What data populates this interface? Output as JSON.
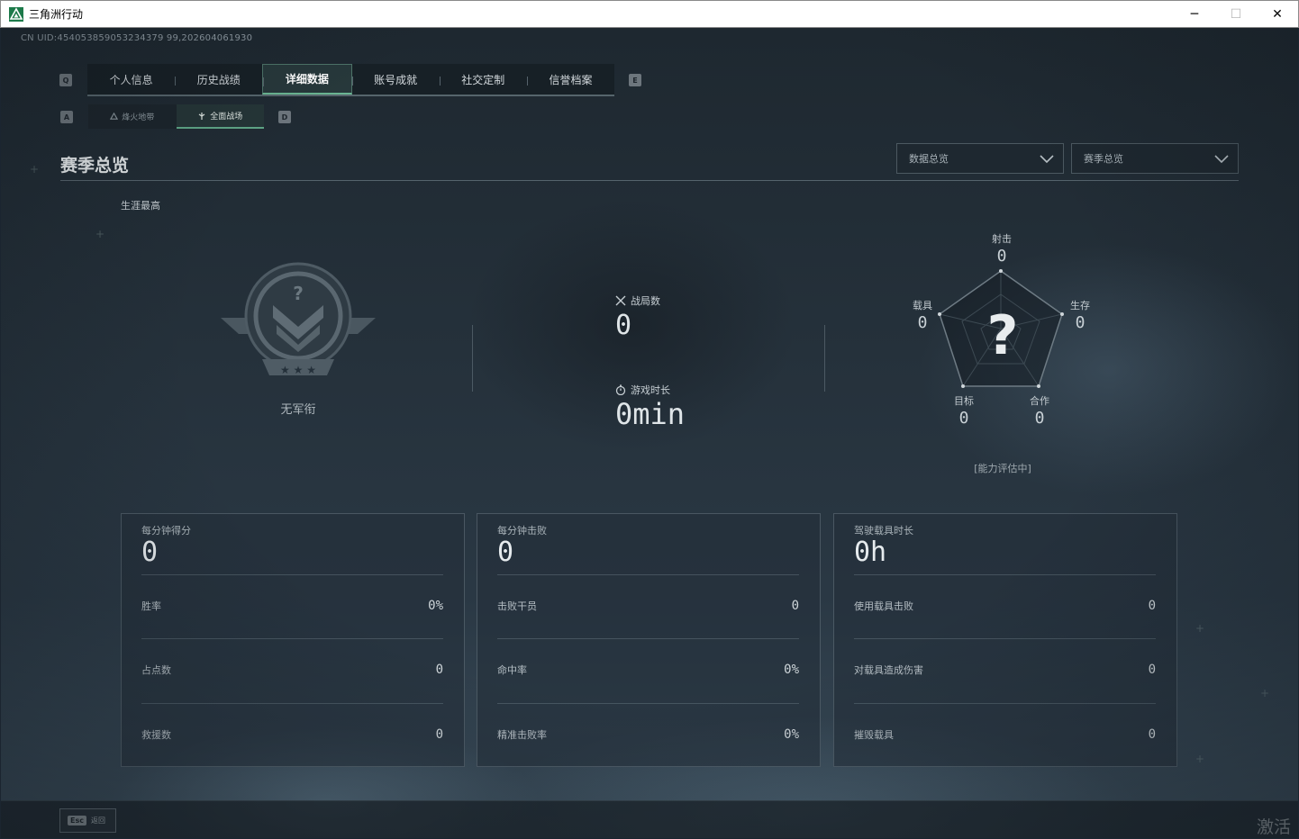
{
  "window": {
    "title": "三角洲行动",
    "minimize": "─",
    "maximize": "☐",
    "close": "✕"
  },
  "uid": "CN UID:454053859053234379 99,202604061930",
  "tabs": {
    "left_key": "Q",
    "right_key": "E",
    "items": [
      {
        "label": "个人信息"
      },
      {
        "label": "历史战绩"
      },
      {
        "label": "详细数据",
        "active": true
      },
      {
        "label": "账号成就"
      },
      {
        "label": "社交定制"
      },
      {
        "label": "信誉档案"
      }
    ]
  },
  "sub_tabs": {
    "left_key": "A",
    "right_key": "D",
    "items": [
      {
        "label": "烽火地带"
      },
      {
        "label": "全面战场",
        "active": true
      }
    ]
  },
  "section_title": "赛季总览",
  "dropdowns": {
    "data_view": "数据总览",
    "season": "赛季总览"
  },
  "career_label": "生涯最高",
  "rank": {
    "name": "无军衔"
  },
  "middle": {
    "matches_label": "战局数",
    "matches_value": "0",
    "playtime_label": "游戏时长",
    "playtime_value": "0min"
  },
  "radar": {
    "center_mark": "?",
    "shooting": {
      "label": "射击",
      "value": "0"
    },
    "survival": {
      "label": "生存",
      "value": "0"
    },
    "cooperation": {
      "label": "合作",
      "value": "0"
    },
    "objective": {
      "label": "目标",
      "value": "0"
    },
    "vehicle": {
      "label": "载具",
      "value": "0"
    },
    "status": "[能力评估中]"
  },
  "cards": [
    {
      "title": "每分钟得分",
      "value": "0",
      "rows": [
        {
          "label": "胜率",
          "value": "0%"
        },
        {
          "label": "占点数",
          "value": "0"
        },
        {
          "label": "救援数",
          "value": "0"
        }
      ]
    },
    {
      "title": "每分钟击败",
      "value": "0",
      "rows": [
        {
          "label": "击败干员",
          "value": "0"
        },
        {
          "label": "命中率",
          "value": "0%"
        },
        {
          "label": "精准击败率",
          "value": "0%"
        }
      ]
    },
    {
      "title": "驾驶载具时长",
      "value": "0h",
      "rows": [
        {
          "label": "使用载具击败",
          "value": "0"
        },
        {
          "label": "对载具造成伤害",
          "value": "0"
        },
        {
          "label": "摧毁载具",
          "value": "0"
        }
      ]
    }
  ],
  "footer": {
    "esc_key": "Esc",
    "back_label": "返回"
  },
  "watermark": "激活"
}
